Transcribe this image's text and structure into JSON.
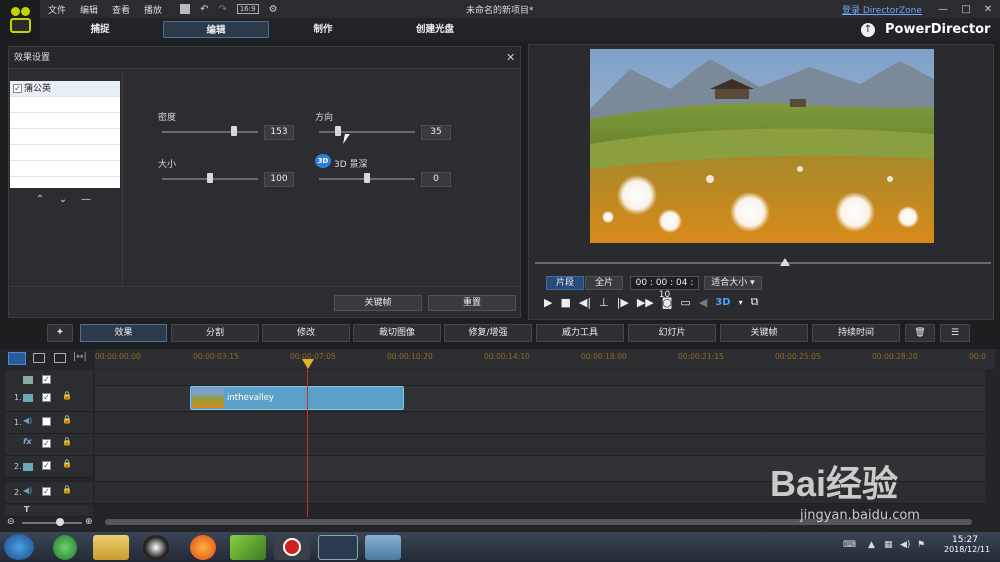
{
  "menu": {
    "items": [
      "文件",
      "编辑",
      "查看",
      "播放"
    ],
    "title": "未命名的新项目*",
    "login": "登录 DirectorZone",
    "brand": "PowerDirector",
    "aspect": "16:9"
  },
  "tabs": [
    "捕捉",
    "编辑",
    "制作",
    "创建光盘"
  ],
  "effect_panel": {
    "title": "效果设置",
    "effect_name": "蒲公英",
    "sliders": {
      "density": {
        "label": "密度",
        "value": "153"
      },
      "direction": {
        "label": "方向",
        "value": "35"
      },
      "size": {
        "label": "大小",
        "value": "100"
      },
      "depth": {
        "label": "3D 景深",
        "value": "0"
      }
    },
    "keyframe": "关键帧",
    "reset": "重置",
    "badge_3d": "3D"
  },
  "preview": {
    "mode_clip": "片段",
    "mode_full": "全片",
    "timecode": "00 : 00 : 04 : 10",
    "fit": "适合大小",
    "badge_3d": "3D"
  },
  "tools": [
    "效果",
    "分割",
    "修改",
    "裁切图像",
    "修复/增强",
    "威力工具",
    "幻灯片",
    "关键帧",
    "持续时间"
  ],
  "timeline": {
    "ticks": [
      "00:00:00:00",
      "00:00:03:15",
      "00:00:07:05",
      "00:00:10:20",
      "00:00:14:10",
      "00:00:18:00",
      "00:00:21:15",
      "00:00:25:05",
      "00:00:28:20",
      "00:0"
    ],
    "clip": "inthevalley",
    "tracks": [
      "",
      "1.",
      "1.",
      "",
      "2.",
      "2.",
      ""
    ]
  },
  "taskbar": {
    "time": "15:27",
    "date": "2018/12/11"
  },
  "watermark": {
    "text": "Bai经验",
    "url": "jingyan.baidu.com"
  }
}
